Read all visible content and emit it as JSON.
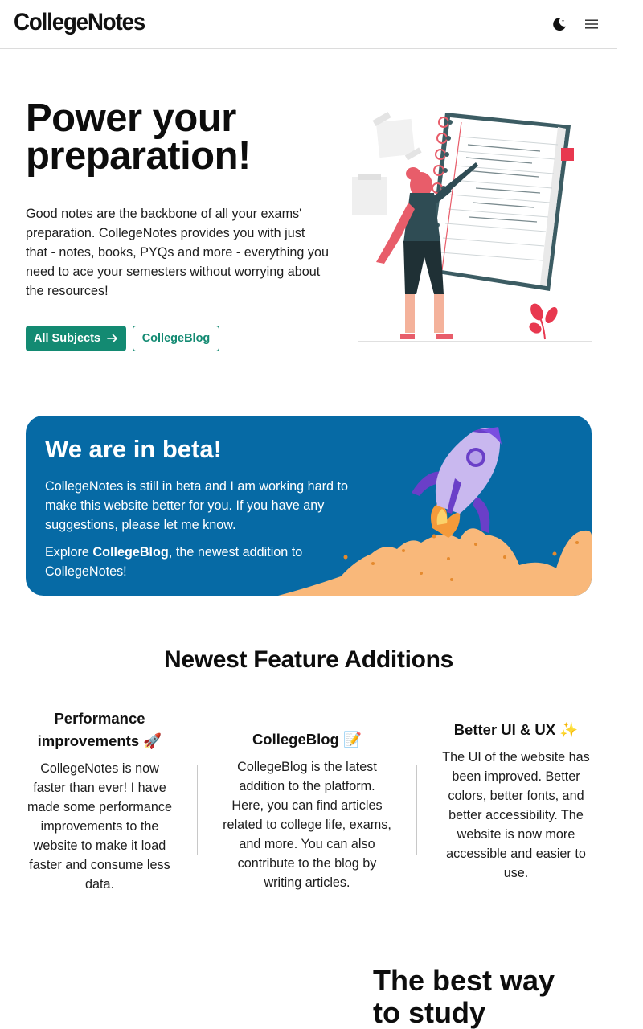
{
  "header": {
    "brand": "CollegeNotes",
    "theme_icon": "moon-icon",
    "menu_icon": "hamburger-menu-icon"
  },
  "hero": {
    "title_line1": "Power your",
    "title_line2": "preparation!",
    "description": "Good notes are the backbone of all your exams' preparation. CollegeNotes provides you with just that - notes, books, PYQs and more - everything you need to ace your semesters without worrying about the resources!",
    "primary_button": "All Subjects",
    "primary_button_icon": "arrow-right-icon",
    "secondary_button": "CollegeBlog"
  },
  "beta": {
    "title": "We are in beta!",
    "paragraph1": "CollegeNotes is still in beta and I am working hard to make this website better for you. If you have any suggestions, please let me know.",
    "paragraph2_prefix": "Explore ",
    "paragraph2_bold": "CollegeBlog",
    "paragraph2_suffix": ", the newest addition to CollegeNotes!"
  },
  "features": {
    "title": "Newest Feature Additions",
    "items": [
      {
        "title": "Performance improvements 🚀",
        "text": "CollegeNotes is now faster than ever! I have made some performance improvements to the website to make it load faster and consume less data."
      },
      {
        "title": "CollegeBlog 📝",
        "text": "CollegeBlog is the latest addition to the platform. Here, you can find articles related to college life, exams, and more. You can also contribute to the blog by writing articles."
      },
      {
        "title": "Better UI & UX ✨",
        "text": "The UI of the website has been improved. Better colors, better fonts, and better accessibility. The website is now more accessible and easier to use."
      }
    ]
  },
  "study": {
    "title_line1": "The best way",
    "title_line2": "to study"
  },
  "colors": {
    "accent": "#138a72",
    "beta_bg": "#066aa5"
  }
}
